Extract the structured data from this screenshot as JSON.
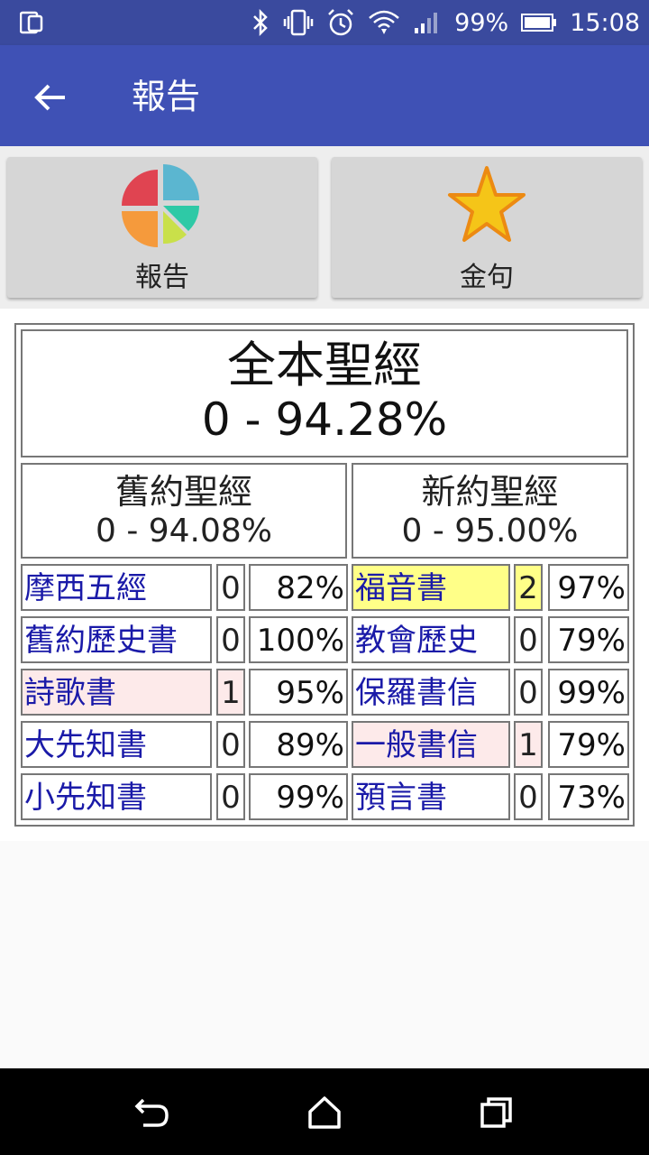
{
  "status_bar": {
    "battery": "99%",
    "time": "15:08",
    "icons": [
      "screen-icon",
      "bluetooth-icon",
      "vibrate-icon",
      "alarm-icon",
      "wifi-icon",
      "signal-icon",
      "battery-icon"
    ]
  },
  "app_bar": {
    "title": "報告",
    "back_icon": "arrow-back-icon"
  },
  "buttons": {
    "report_label": "報告",
    "verse_label": "金句"
  },
  "report": {
    "whole": {
      "title": "全本聖經",
      "value": "0 - 94.28%"
    },
    "old_testament": {
      "title": "舊約聖經",
      "value": "0 - 94.08%"
    },
    "new_testament": {
      "title": "新約聖經",
      "value": "0 - 95.00%"
    },
    "old_groups": [
      {
        "name": "摩西五經",
        "count": "0",
        "percent": "82%",
        "highlight": "#ffffff"
      },
      {
        "name": "舊約歷史書",
        "count": "0",
        "percent": "100%",
        "highlight": "#ffffff"
      },
      {
        "name": "詩歌書",
        "count": "1",
        "percent": "95%",
        "highlight": "#fdeaea"
      },
      {
        "name": "大先知書",
        "count": "0",
        "percent": "89%",
        "highlight": "#ffffff"
      },
      {
        "name": "小先知書",
        "count": "0",
        "percent": "99%",
        "highlight": "#ffffff"
      }
    ],
    "new_groups": [
      {
        "name": "福音書",
        "count": "2",
        "percent": "97%",
        "highlight": "#ffff88"
      },
      {
        "name": "教會歷史",
        "count": "0",
        "percent": "79%",
        "highlight": "#ffffff"
      },
      {
        "name": "保羅書信",
        "count": "0",
        "percent": "99%",
        "highlight": "#ffffff"
      },
      {
        "name": "一般書信",
        "count": "1",
        "percent": "79%",
        "highlight": "#fdeaea"
      },
      {
        "name": "預言書",
        "count": "0",
        "percent": "73%",
        "highlight": "#ffffff"
      }
    ]
  },
  "colors": {
    "status_bar": "#3a4a9e",
    "app_bar": "#3f51b5",
    "link_text": "#1a1aa8",
    "star": "#f5c518"
  },
  "nav": {
    "icons": [
      "back-nav-icon",
      "home-nav-icon",
      "recents-nav-icon"
    ]
  }
}
